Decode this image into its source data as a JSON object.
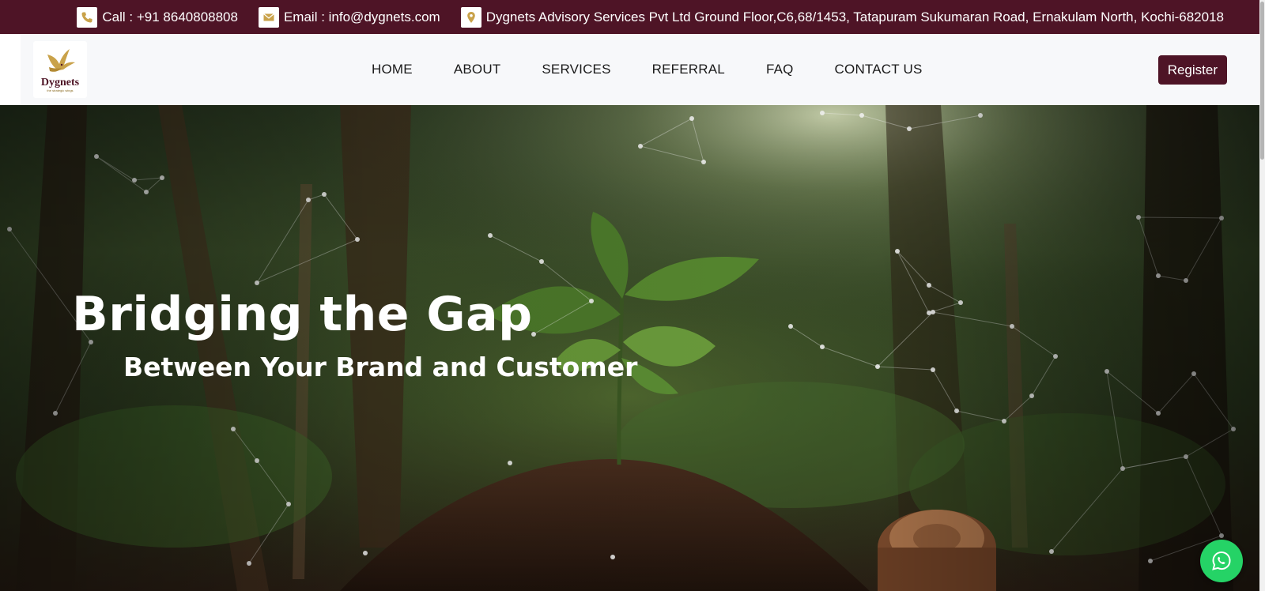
{
  "topbar": {
    "phone": "Call : +91 8640808808",
    "email": "Email : info@dygnets.com",
    "address": "Dygnets Advisory Services Pvt Ltd Ground Floor,C6,68/1453, Tatapuram Sukumaran Road, Ernakulam North, Kochi-682018",
    "icons": [
      "phone-icon",
      "envelope-icon",
      "map-pin-icon"
    ],
    "bg_color": "#4e1426",
    "icon_color": "#c9a24a"
  },
  "brand": {
    "name": "Dygnets",
    "tagline": "the strategic wings",
    "color": "#4e1426",
    "accent": "#c9a24a"
  },
  "nav": {
    "items": [
      "HOME",
      "ABOUT",
      "SERVICES",
      "REFERRAL",
      "FAQ",
      "CONTACT US"
    ]
  },
  "header": {
    "register_label": "Register"
  },
  "hero": {
    "title": "Bridging the Gap",
    "subtitle": "Between Your Brand and Customer"
  },
  "whatsapp": {
    "icon": "whatsapp-icon",
    "color": "#25d366"
  }
}
